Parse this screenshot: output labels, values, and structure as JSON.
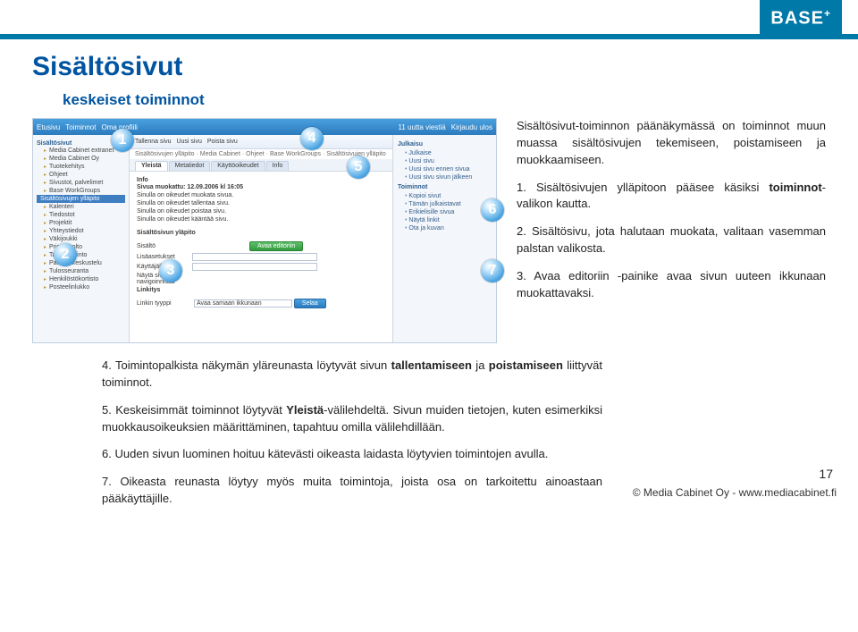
{
  "logo": "BASE",
  "logo_plus": "+",
  "title": "Sisältösivut",
  "subtitle": "keskeiset toiminnot",
  "callouts": {
    "c1": "1",
    "c2": "2",
    "c3": "3",
    "c4": "4",
    "c5": "5",
    "c6": "6",
    "c7": "7"
  },
  "intro": "Sisältösivut-toiminnon päänäkymässä on toiminnot muun muassa sisältösivujen tekemiseen, poistamiseen ja muokkaamiseen.",
  "p1_num": "1.",
  "p1_a": "Sisältösivujen ylläpitoon pääsee käsiksi ",
  "p1_kw": "toiminnot",
  "p1_b": "-valikon kautta.",
  "p2_num": "2.",
  "p2": "Sisältösivu, jota halutaan muokata, valitaan vasemman palstan valikosta.",
  "p3_num": "3.",
  "p3": "Avaa editoriin -painike avaa sivun uuteen ikkunaan muokattavaksi.",
  "p4_num": "4.",
  "p4_a": "Toimintopalkista näkymän yläreunasta löytyvät sivun ",
  "p4_kw": "tallentamiseen",
  "p4_b": " ja ",
  "p4_kw2": "poistamiseen",
  "p4_c": " liittyvät toiminnot.",
  "p5_num": "5.",
  "p5_a": "Keskeisimmät toiminnot löytyvät ",
  "p5_kw": "Yleistä",
  "p5_b": "-välilehdeltä. Sivun muiden tietojen, kuten esimerkiksi muokkausoikeuksien määrittäminen, tapahtuu omilla välilehdillään.",
  "p6_num": "6.",
  "p6": "Uuden sivun luominen hoituu kätevästi oikeasta laidasta löytyvien toimintojen avulla.",
  "p7_num": "7.",
  "p7": "Oikeasta reunasta löytyy myös muita toimintoja, joista osa on tarkoitettu ainoastaan pääkäyttäjille.",
  "page_number": "17",
  "footer": "© Media Cabinet Oy - www.mediacabinet.fi",
  "shot": {
    "hdr_items": [
      "Etusivu",
      "Toiminnot",
      "Oma profiili",
      "11 uutta viestiä",
      "Kirjaudu ulos"
    ],
    "toolbar": [
      "Tallenna sivu",
      "Uusi sivu",
      "Poista sivu"
    ],
    "breadcrumb": "Sisältösivujen ylläpito · Media Cabinet · Ohjeet · Base WorkGroups · Sisältösivujen ylläpito",
    "side_top": "Sisältösivut",
    "side_items": [
      "Media Cabinet extranet",
      "Media Cabinet Oy",
      "Tuotekehitys",
      "Ohjeet",
      "Sivustot, palvelimet",
      "Base WorkGroups",
      "Kalenteri",
      "Tiedostot",
      "Projektit",
      "Yhteystiedot",
      "Väkijoukki",
      "Printtihuolto",
      "Taloushallinto",
      "Palaute keskustelu",
      "Tulosseuranta",
      "Henkilöstökortisto",
      "Posteelinlukko"
    ],
    "side_selected": "Sisältösivujen ylläpito",
    "tabs": [
      "Yleistä",
      "Metatiedot",
      "Käyttöoikeudet",
      "Info"
    ],
    "info_title": "Info",
    "info_line1": "Sivua muokattu: 12.09.2006 kl 16:05",
    "info_rows": [
      "Sinulla on oikeudet muokata sivua.",
      "Sinulla on oikeudet tallentaa sivu.",
      "Sinulla on oikeudet poistaa sivu.",
      "Sinulla on oikeudet kääntää sivu."
    ],
    "form_h": "Sisältösivun yläpito",
    "form_rows": {
      "sisalto": "Sisältö",
      "editor_btn": "Avaa editoriin",
      "lisaa": "Lisäasetukset",
      "kayt": "Käyttäjälle",
      "nayta": "Näytä sivu navigoinnissa",
      "linkit": "Linkitys",
      "linkin": "Linkin tyyppi",
      "linkin_val": "Avaa samaan ikkunaan"
    },
    "save_btn": "Selaa",
    "right": {
      "h1": "Julkaisu",
      "r1": [
        "Julkaise",
        "Uusi sivu",
        "Uusi sivu ennen sivua",
        "Uusi sivu sivun jälkeen"
      ],
      "h2": "Toiminnot",
      "r2": [
        "Kopioi sivut",
        "Tämän julkaistavat",
        "Erikielisille sivua",
        "Näytä linkit",
        "Ota ja kuvan"
      ]
    }
  }
}
